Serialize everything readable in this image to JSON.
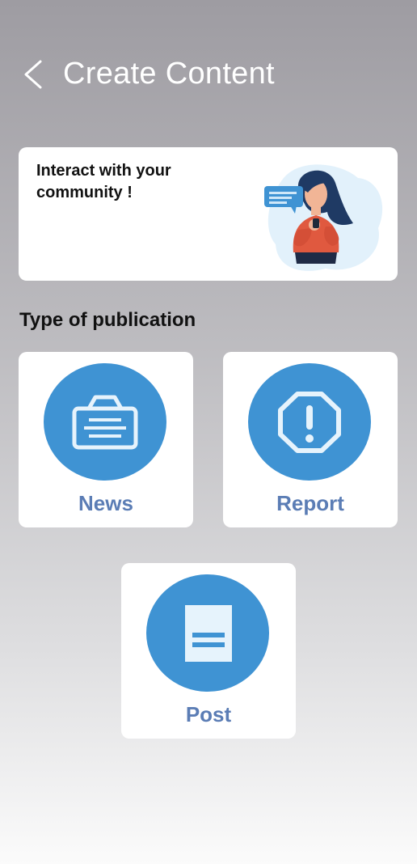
{
  "header": {
    "back_icon": "chevron-left-icon",
    "title": "Create Content"
  },
  "banner": {
    "text": "Interact with your community !",
    "illustration": "woman-chatting-illustration"
  },
  "publication": {
    "section_title": "Type of publication",
    "types": [
      {
        "label": "News",
        "icon": "news-sign-icon"
      },
      {
        "label": "Report",
        "icon": "alert-octagon-icon"
      },
      {
        "label": "Post",
        "icon": "document-icon"
      }
    ]
  },
  "colors": {
    "accent": "#3f93d3",
    "label": "#5b7db5",
    "card": "#ffffff",
    "icon_fill": "#e6f3fc"
  }
}
